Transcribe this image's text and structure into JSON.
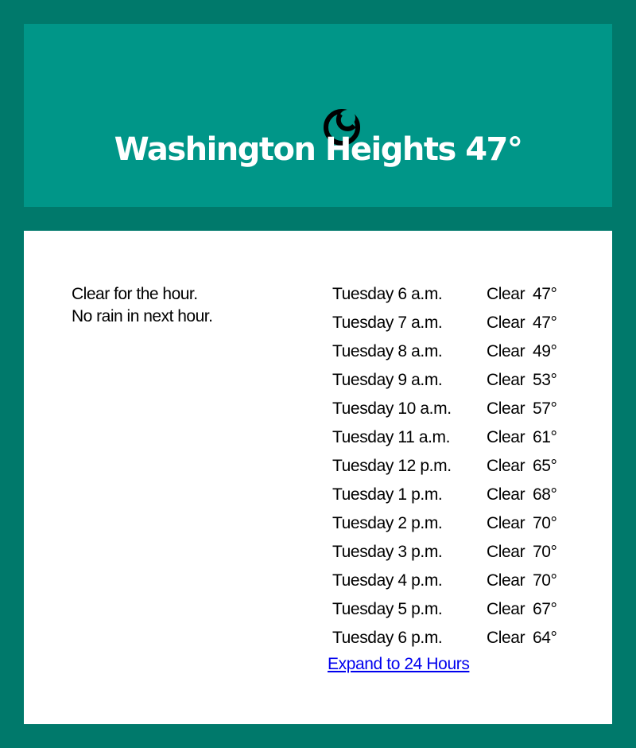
{
  "header": {
    "icon": "moon-icon",
    "location": "Washington Heights",
    "temperature": "47°",
    "title": "Washington Heights 47°"
  },
  "summary": {
    "line1": "Clear for the hour.",
    "line2": "No rain in next hour."
  },
  "forecast": [
    {
      "time": "Tuesday 6 a.m.",
      "condition": "Clear",
      "temp": "47°"
    },
    {
      "time": "Tuesday 7 a.m.",
      "condition": "Clear",
      "temp": "47°"
    },
    {
      "time": "Tuesday 8 a.m.",
      "condition": "Clear",
      "temp": "49°"
    },
    {
      "time": "Tuesday 9 a.m.",
      "condition": "Clear",
      "temp": "53°"
    },
    {
      "time": "Tuesday 10 a.m.",
      "condition": "Clear",
      "temp": "57°"
    },
    {
      "time": "Tuesday 11 a.m.",
      "condition": "Clear",
      "temp": "61°"
    },
    {
      "time": "Tuesday 12 p.m.",
      "condition": "Clear",
      "temp": "65°"
    },
    {
      "time": "Tuesday 1 p.m.",
      "condition": "Clear",
      "temp": "68°"
    },
    {
      "time": "Tuesday 2 p.m.",
      "condition": "Clear",
      "temp": "70°"
    },
    {
      "time": "Tuesday 3 p.m.",
      "condition": "Clear",
      "temp": "70°"
    },
    {
      "time": "Tuesday 4 p.m.",
      "condition": "Clear",
      "temp": "70°"
    },
    {
      "time": "Tuesday 5 p.m.",
      "condition": "Clear",
      "temp": "67°"
    },
    {
      "time": "Tuesday 6 p.m.",
      "condition": "Clear",
      "temp": "64°"
    }
  ],
  "expand_link": "Expand to 24 Hours",
  "colors": {
    "frame": "#00796b",
    "header": "#009688",
    "panel": "#ffffff",
    "title_text": "#ffffff",
    "link": "#0000ee"
  }
}
